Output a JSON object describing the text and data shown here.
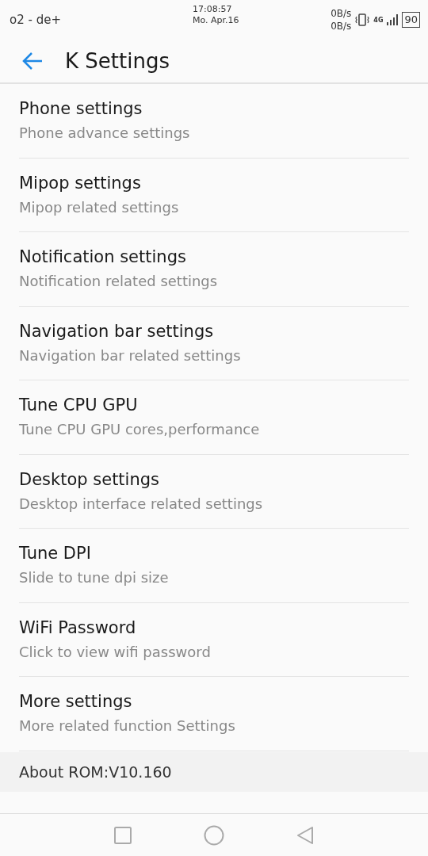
{
  "status_bar": {
    "carrier": "o2 - de+",
    "time": "17:08:57",
    "date": "Mo. Apr.16",
    "speed_up": "0B/s",
    "speed_down": "0B/s",
    "network": "4G",
    "battery": "90"
  },
  "app_bar": {
    "title": "K Settings"
  },
  "items": [
    {
      "title": "Phone settings",
      "subtitle": "Phone advance settings"
    },
    {
      "title": "Mipop settings",
      "subtitle": "Mipop related settings"
    },
    {
      "title": "Notification settings",
      "subtitle": "Notification related settings"
    },
    {
      "title": "Navigation bar settings",
      "subtitle": "Navigation bar related settings"
    },
    {
      "title": "Tune CPU GPU",
      "subtitle": "Tune CPU GPU cores,performance"
    },
    {
      "title": "Desktop settings",
      "subtitle": "Desktop interface related settings"
    },
    {
      "title": "Tune DPI",
      "subtitle": "Slide to tune dpi size"
    },
    {
      "title": "WiFi Password",
      "subtitle": "Click to view wifi password"
    },
    {
      "title": "More settings",
      "subtitle": "More related function Settings"
    }
  ],
  "section": {
    "title": "About ROM:V10.160"
  }
}
